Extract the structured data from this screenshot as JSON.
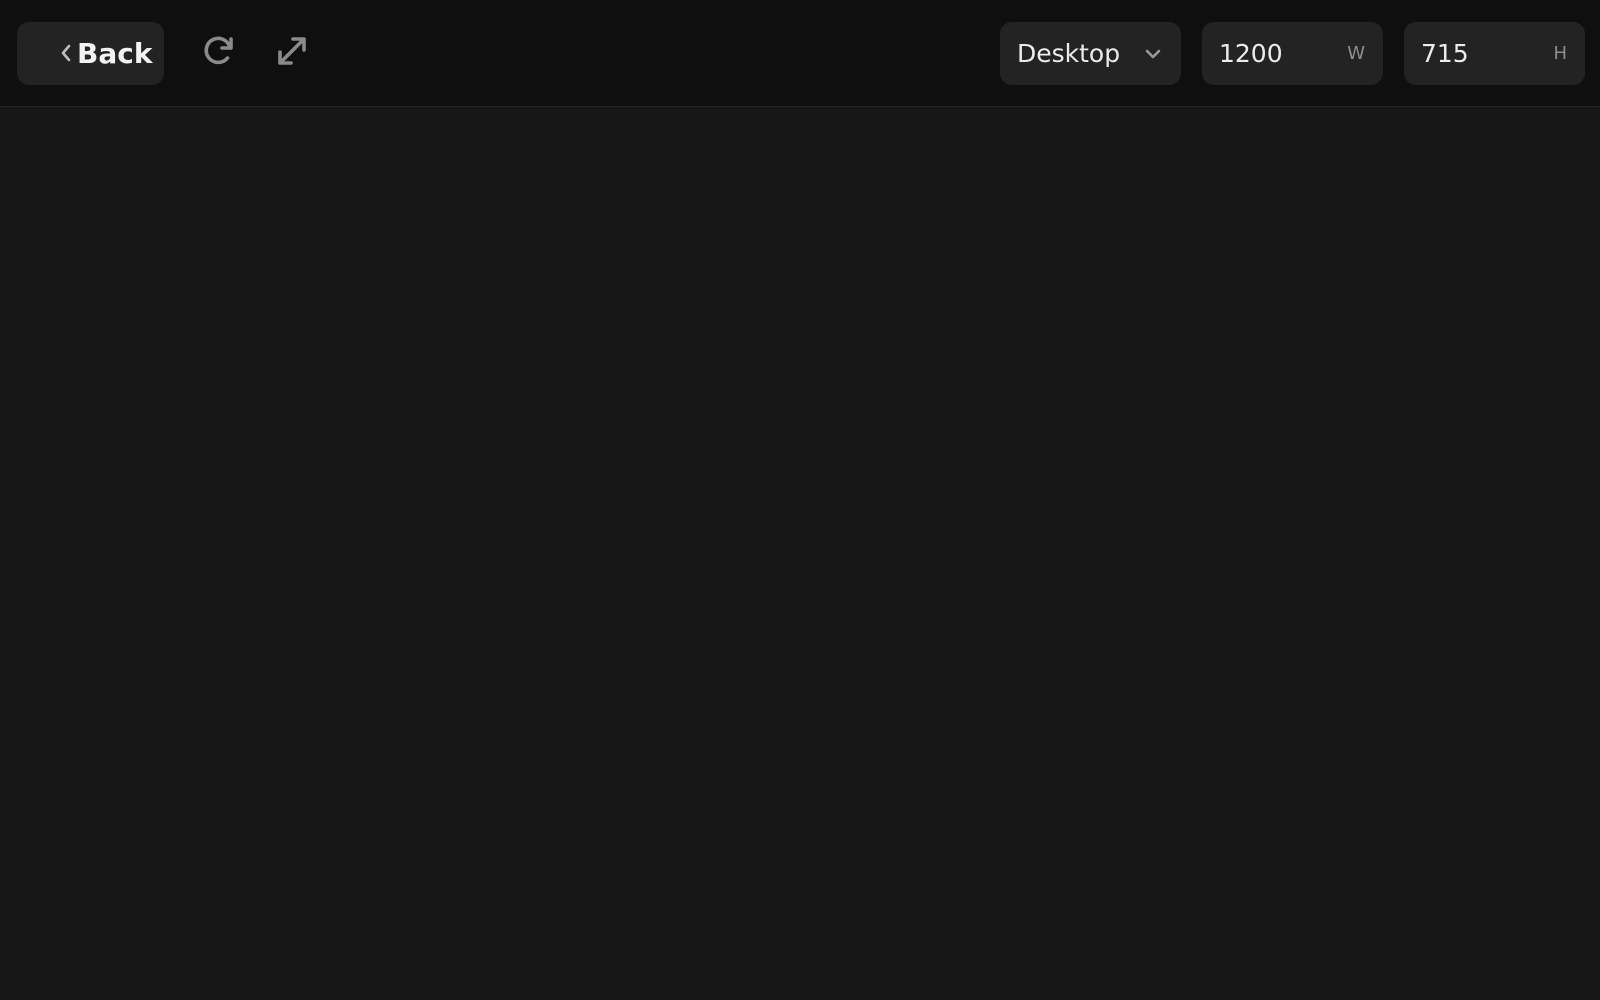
{
  "toolbar": {
    "back_label": "Back",
    "device": {
      "selected": "Desktop"
    },
    "width": {
      "value": "1200",
      "unit": "W"
    },
    "height": {
      "value": "715",
      "unit": "H"
    }
  },
  "icons": {
    "back": "chevron-left-icon",
    "refresh": "refresh-icon",
    "expand": "expand-icon",
    "dropdown": "chevron-down-icon"
  },
  "colors": {
    "toolbar_bg": "#0f0f10",
    "control_bg": "#232324",
    "canvas_bg": "#171717",
    "icon": "#8a8a8a"
  }
}
